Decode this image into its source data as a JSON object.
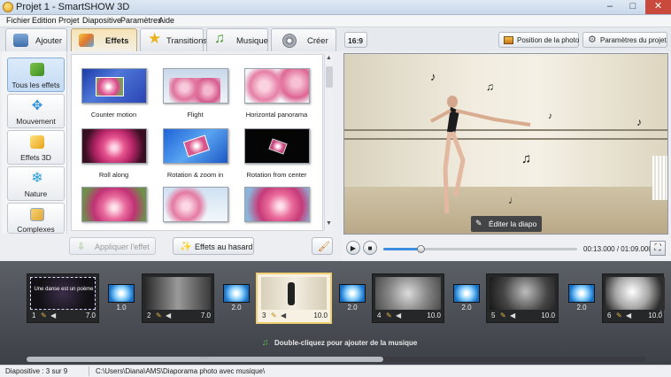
{
  "window": {
    "title": "Projet 1 - SmartSHOW 3D",
    "min_glyph": "–",
    "max_glyph": "□",
    "close_glyph": "✕"
  },
  "menu": [
    "Fichier",
    "Edition",
    "Projet",
    "Diapositive",
    "Paramètres",
    "Aide"
  ],
  "tabs": [
    {
      "label": "Ajouter",
      "icon": "camera-icon",
      "active": false
    },
    {
      "label": "Effets",
      "icon": "brush-icon",
      "active": true
    },
    {
      "label": "Transitions",
      "icon": "star-icon",
      "active": false
    },
    {
      "label": "Musique",
      "icon": "music-note-icon",
      "active": false
    },
    {
      "label": "Créer",
      "icon": "film-reel-icon",
      "active": false
    }
  ],
  "categories": [
    {
      "label": "Tous les effets",
      "icon": "puzzle-icon",
      "active": true
    },
    {
      "label": "Mouvement",
      "icon": "move-arrows-icon",
      "active": false
    },
    {
      "label": "Effets 3D",
      "icon": "cube-icon",
      "active": false
    },
    {
      "label": "Nature",
      "icon": "snowflake-icon",
      "active": false
    },
    {
      "label": "Complexes",
      "icon": "layers-icon",
      "active": false
    }
  ],
  "effects": [
    {
      "label": "Counter motion"
    },
    {
      "label": "Flight"
    },
    {
      "label": "Horizontal panorama"
    },
    {
      "label": "Roll along"
    },
    {
      "label": "Rotation & zoom in"
    },
    {
      "label": "Rotation from center"
    },
    {
      "label": ""
    },
    {
      "label": ""
    },
    {
      "label": ""
    }
  ],
  "effects_buttons": {
    "apply": "Appliquer l'effet",
    "random": "Effets au hasard"
  },
  "preview_toolbar": {
    "ratio": "16:9",
    "photo_position": "Position de la photo",
    "project_settings": "Paramètres du projet"
  },
  "preview": {
    "edit_label": "Éditer la diapo"
  },
  "player": {
    "time": "00:13.000 / 01:09.000",
    "progress": 0.19
  },
  "timeline": {
    "slides": [
      {
        "num": "1",
        "duration": "7.0",
        "caption": "Une danse est un poème"
      },
      {
        "num": "2",
        "duration": "7.0",
        "caption": ""
      },
      {
        "num": "3",
        "duration": "10.0",
        "caption": ""
      },
      {
        "num": "4",
        "duration": "10.0",
        "caption": ""
      },
      {
        "num": "5",
        "duration": "10.0",
        "caption": ""
      },
      {
        "num": "6",
        "duration": "10.0",
        "caption": ""
      }
    ],
    "transitions": [
      {
        "duration": "1.0"
      },
      {
        "duration": "2.0"
      },
      {
        "duration": "2.0"
      },
      {
        "duration": "2.0"
      },
      {
        "duration": "2.0"
      }
    ],
    "music_hint": "Double-cliquez pour ajouter de la musique",
    "scroll_grip": "::::"
  },
  "status": {
    "slide_info": "Diapositive : 3 sur 9",
    "path": "C:\\Users\\Diana\\AMS\\Diaporama photo avec musique\\"
  }
}
